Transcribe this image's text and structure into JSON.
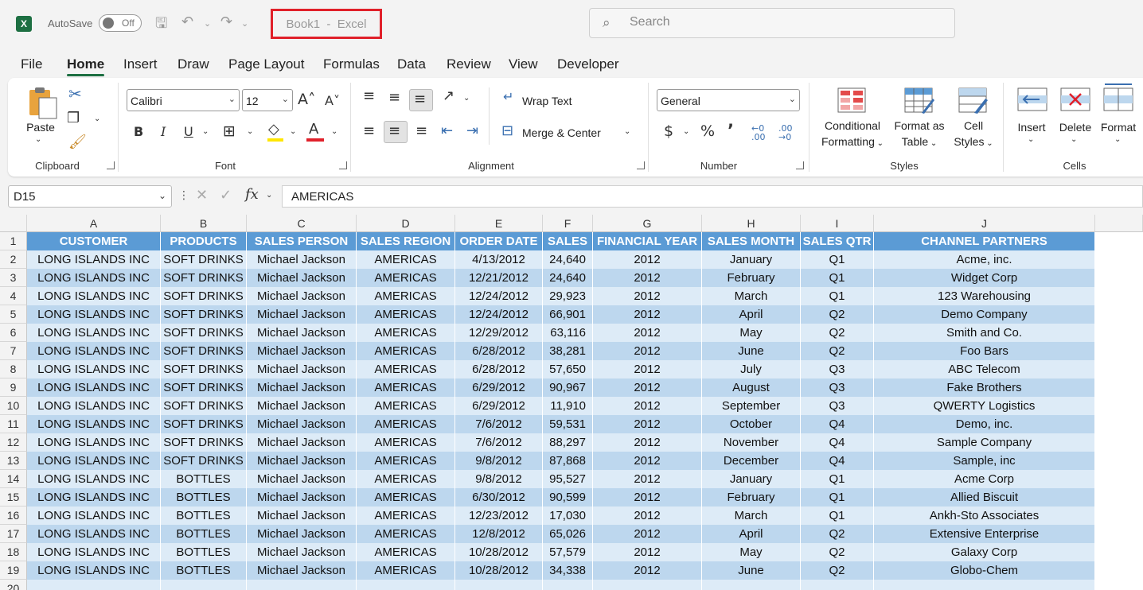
{
  "app": {
    "logo": "X",
    "autosave_label": "AutoSave",
    "autosave_state": "Off",
    "title": "Book1  -  Excel",
    "search_placeholder": "Search"
  },
  "menu": [
    "File",
    "Home",
    "Insert",
    "Draw",
    "Page Layout",
    "Formulas",
    "Data",
    "Review",
    "View",
    "Developer"
  ],
  "ribbon": {
    "clipboard": {
      "paste": "Paste",
      "group": "Clipboard"
    },
    "font": {
      "name": "Calibri",
      "size": "12",
      "group": "Font"
    },
    "alignment": {
      "wrap": "Wrap Text",
      "merge": "Merge & Center",
      "group": "Alignment"
    },
    "number": {
      "format": "General",
      "group": "Number"
    },
    "styles": {
      "conditional_1": "Conditional",
      "conditional_2": "Formatting",
      "format_table_1": "Format as",
      "format_table_2": "Table",
      "cell_styles_1": "Cell",
      "cell_styles_2": "Styles",
      "group": "Styles"
    },
    "cells": {
      "insert": "Insert",
      "delete": "Delete",
      "format": "Format",
      "group": "Cells"
    }
  },
  "formula_bar": {
    "name_box": "D15",
    "content": "AMERICAS"
  },
  "colors": {
    "excel_green": "#1d6f42",
    "header_fill": "#5b9bd5",
    "band_light": "#ddebf7",
    "band_dark": "#bdd7ee",
    "highlight_box": "#e0202a"
  },
  "sheet": {
    "columns": [
      "A",
      "B",
      "C",
      "D",
      "E",
      "F",
      "G",
      "H",
      "I",
      "J"
    ],
    "headers": [
      "CUSTOMER",
      "PRODUCTS",
      "SALES PERSON",
      "SALES REGION",
      "ORDER DATE",
      "SALES",
      "FINANCIAL YEAR",
      "SALES MONTH",
      "SALES QTR",
      "CHANNEL PARTNERS"
    ],
    "rows": [
      [
        "LONG ISLANDS INC",
        "SOFT DRINKS",
        "Michael Jackson",
        "AMERICAS",
        "4/13/2012",
        "24,640",
        "2012",
        "January",
        "Q1",
        "Acme, inc."
      ],
      [
        "LONG ISLANDS INC",
        "SOFT DRINKS",
        "Michael Jackson",
        "AMERICAS",
        "12/21/2012",
        "24,640",
        "2012",
        "February",
        "Q1",
        "Widget Corp"
      ],
      [
        "LONG ISLANDS INC",
        "SOFT DRINKS",
        "Michael Jackson",
        "AMERICAS",
        "12/24/2012",
        "29,923",
        "2012",
        "March",
        "Q1",
        "123 Warehousing"
      ],
      [
        "LONG ISLANDS INC",
        "SOFT DRINKS",
        "Michael Jackson",
        "AMERICAS",
        "12/24/2012",
        "66,901",
        "2012",
        "April",
        "Q2",
        "Demo Company"
      ],
      [
        "LONG ISLANDS INC",
        "SOFT DRINKS",
        "Michael Jackson",
        "AMERICAS",
        "12/29/2012",
        "63,116",
        "2012",
        "May",
        "Q2",
        "Smith and Co."
      ],
      [
        "LONG ISLANDS INC",
        "SOFT DRINKS",
        "Michael Jackson",
        "AMERICAS",
        "6/28/2012",
        "38,281",
        "2012",
        "June",
        "Q2",
        "Foo Bars"
      ],
      [
        "LONG ISLANDS INC",
        "SOFT DRINKS",
        "Michael Jackson",
        "AMERICAS",
        "6/28/2012",
        "57,650",
        "2012",
        "July",
        "Q3",
        "ABC Telecom"
      ],
      [
        "LONG ISLANDS INC",
        "SOFT DRINKS",
        "Michael Jackson",
        "AMERICAS",
        "6/29/2012",
        "90,967",
        "2012",
        "August",
        "Q3",
        "Fake Brothers"
      ],
      [
        "LONG ISLANDS INC",
        "SOFT DRINKS",
        "Michael Jackson",
        "AMERICAS",
        "6/29/2012",
        "11,910",
        "2012",
        "September",
        "Q3",
        "QWERTY Logistics"
      ],
      [
        "LONG ISLANDS INC",
        "SOFT DRINKS",
        "Michael Jackson",
        "AMERICAS",
        "7/6/2012",
        "59,531",
        "2012",
        "October",
        "Q4",
        "Demo, inc."
      ],
      [
        "LONG ISLANDS INC",
        "SOFT DRINKS",
        "Michael Jackson",
        "AMERICAS",
        "7/6/2012",
        "88,297",
        "2012",
        "November",
        "Q4",
        "Sample Company"
      ],
      [
        "LONG ISLANDS INC",
        "SOFT DRINKS",
        "Michael Jackson",
        "AMERICAS",
        "9/8/2012",
        "87,868",
        "2012",
        "December",
        "Q4",
        "Sample, inc"
      ],
      [
        "LONG ISLANDS INC",
        "BOTTLES",
        "Michael Jackson",
        "AMERICAS",
        "9/8/2012",
        "95,527",
        "2012",
        "January",
        "Q1",
        "Acme Corp"
      ],
      [
        "LONG ISLANDS INC",
        "BOTTLES",
        "Michael Jackson",
        "AMERICAS",
        "6/30/2012",
        "90,599",
        "2012",
        "February",
        "Q1",
        "Allied Biscuit"
      ],
      [
        "LONG ISLANDS INC",
        "BOTTLES",
        "Michael Jackson",
        "AMERICAS",
        "12/23/2012",
        "17,030",
        "2012",
        "March",
        "Q1",
        "Ankh-Sto Associates"
      ],
      [
        "LONG ISLANDS INC",
        "BOTTLES",
        "Michael Jackson",
        "AMERICAS",
        "12/8/2012",
        "65,026",
        "2012",
        "April",
        "Q2",
        "Extensive Enterprise"
      ],
      [
        "LONG ISLANDS INC",
        "BOTTLES",
        "Michael Jackson",
        "AMERICAS",
        "10/28/2012",
        "57,579",
        "2012",
        "May",
        "Q2",
        "Galaxy Corp"
      ],
      [
        "LONG ISLANDS INC",
        "BOTTLES",
        "Michael Jackson",
        "AMERICAS",
        "10/28/2012",
        "34,338",
        "2012",
        "June",
        "Q2",
        "Globo-Chem"
      ]
    ]
  }
}
